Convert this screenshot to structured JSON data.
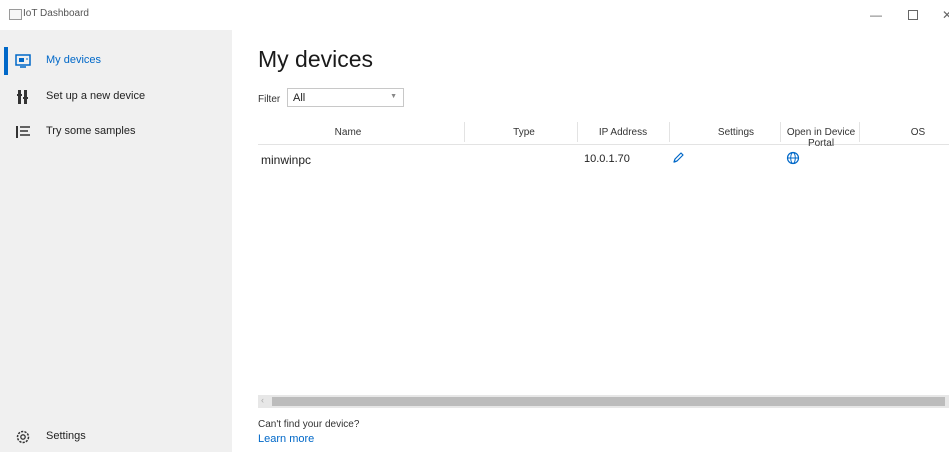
{
  "window": {
    "title": "IoT Dashboard",
    "minimize": "—",
    "close": "✕"
  },
  "sidebar": {
    "items": [
      {
        "label": "My devices",
        "icon": "devices-icon",
        "selected": true
      },
      {
        "label": "Set up a new device",
        "icon": "setup-device-icon",
        "selected": false
      },
      {
        "label": "Try some samples",
        "icon": "samples-icon",
        "selected": false
      }
    ],
    "settings_label": "Settings",
    "accent": "#0068c8"
  },
  "main": {
    "title": "My devices",
    "filter": {
      "label": "Filter",
      "value": "All"
    },
    "table": {
      "columns": [
        "Name",
        "Type",
        "IP Address",
        "Settings",
        "Open in Device Portal",
        "OS"
      ],
      "rows": [
        {
          "name": "minwinpc",
          "type": "",
          "ip": "10.0.1.70",
          "settings": "edit-icon",
          "portal": "globe-icon",
          "os": ""
        }
      ]
    },
    "footer": {
      "help_text": "Can't find your device?",
      "link": "Learn more"
    }
  }
}
